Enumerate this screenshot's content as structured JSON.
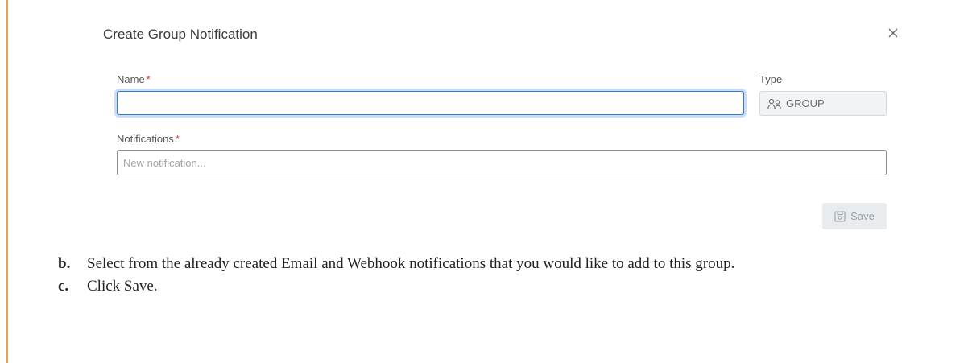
{
  "dialog": {
    "title": "Create Group Notification",
    "name_label": "Name",
    "required_mark": "*",
    "name_value": "",
    "type_label": "Type",
    "type_value": "GROUP",
    "notifications_label": "Notifications",
    "notifications_placeholder": "New notification...",
    "save_label": "Save"
  },
  "steps": [
    {
      "letter": "b.",
      "text": "Select from the already created Email and Webhook notifications that you would like to add to this group."
    },
    {
      "letter": "c.",
      "text": "Click Save."
    }
  ],
  "colors": {
    "accent_rule": "#f0a04b",
    "focus_border": "#2f7fd0",
    "required": "#e53935"
  }
}
